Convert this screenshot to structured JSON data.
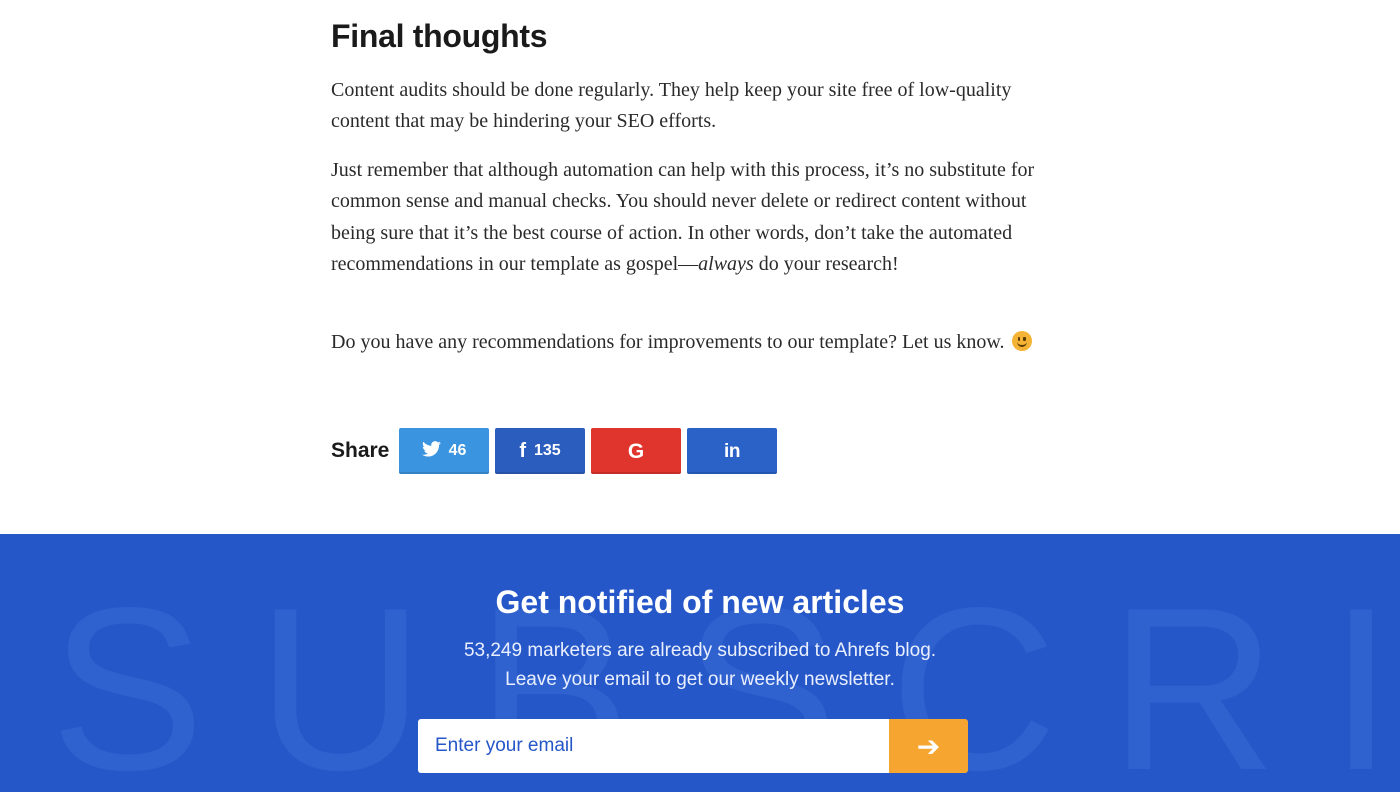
{
  "article": {
    "heading": "Final thoughts",
    "paragraph_1": "Content audits should be done regularly. They help keep your site free of low-quality content that may be hindering your SEO efforts.",
    "paragraph_2_before": "Just remember that although automation can help with this process, it’s no substitute for common sense and manual checks. You should never delete or redirect content without being sure that it’s the best course of action. In other words, don’t take the automated recommendations in our template as gospel—",
    "paragraph_2_emphasis": "always",
    "paragraph_2_after": " do your research!",
    "paragraph_3": "Do you have any recommendations for improvements to our template? Let us know.",
    "emoji_icon": "slightly-smiling-face"
  },
  "share": {
    "label": "Share",
    "twitter": {
      "icon": "twitter-icon",
      "glyph": "🐦",
      "count": "46",
      "color": "#3b94e0"
    },
    "facebook": {
      "icon": "facebook-icon",
      "glyph": "f",
      "count": "135",
      "color": "#2b5dbf"
    },
    "google": {
      "icon": "google-icon",
      "glyph": "G",
      "color": "#e0352c"
    },
    "linkedin": {
      "icon": "linkedin-icon",
      "glyph": "in",
      "color": "#2a62c8"
    }
  },
  "subscribe": {
    "background_word": "SUBSCRIBE",
    "title": "Get notified of new articles",
    "line_1": "53,249 marketers are already subscribed to Ahrefs blog.",
    "line_2": "Leave your email to get our weekly newsletter.",
    "email_placeholder": "Enter your email",
    "submit_icon": "arrow-right-icon",
    "submit_glyph": "➔",
    "background_color": "#2557c8",
    "submit_color": "#f6a531"
  }
}
